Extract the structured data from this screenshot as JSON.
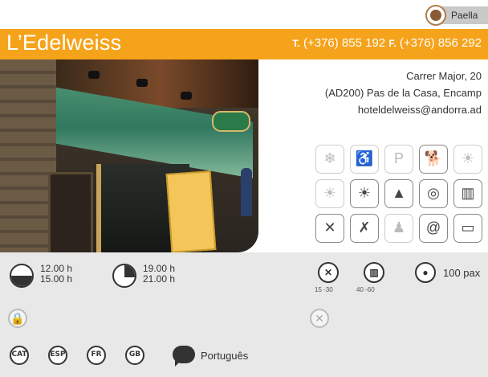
{
  "tag": {
    "label": "Paella",
    "icon": "chef-hat-icon"
  },
  "header": {
    "name": "L’Edelweiss",
    "phone_prefix": "T.",
    "phone": "(+376) 855 192",
    "fax_prefix": "F.",
    "fax": "(+376) 856 292",
    "bar_color": "#f5a31b"
  },
  "photo": {
    "subject": "restaurant-facade"
  },
  "address": {
    "street": "Carrer Major, 20",
    "city": "(AD200) Pas de la Casa, Encamp",
    "email": "hoteldelweiss@andorra.ad"
  },
  "services": [
    {
      "icon": "air-conditioning-icon",
      "glyph": "❄",
      "active": false
    },
    {
      "icon": "wheelchair-icon",
      "glyph": "♿",
      "active": false
    },
    {
      "icon": "parking-icon",
      "glyph": "P",
      "active": false
    },
    {
      "icon": "pets-allowed-icon",
      "glyph": "🐕",
      "active": true
    },
    {
      "icon": "terrace-sun-icon",
      "glyph": "☀",
      "active": false
    },
    {
      "icon": "outdoor-seating-icon",
      "glyph": "☀",
      "active": false
    },
    {
      "icon": "sunset-view-icon",
      "glyph": "☀",
      "active": true
    },
    {
      "icon": "mountain-trees-icon",
      "glyph": "▲",
      "active": true
    },
    {
      "icon": "center-location-icon",
      "glyph": "◎",
      "active": true
    },
    {
      "icon": "menu-book-icon",
      "glyph": "▥",
      "active": true
    },
    {
      "icon": "cutlery-icon",
      "glyph": "✕",
      "active": true
    },
    {
      "icon": "gluten-free-icon",
      "glyph": "✗",
      "active": true
    },
    {
      "icon": "chef-icon",
      "glyph": "♟",
      "active": false
    },
    {
      "icon": "email-at-icon",
      "glyph": "@",
      "active": true
    },
    {
      "icon": "credit-card-icon",
      "glyph": "▭",
      "active": true
    }
  ],
  "hours": {
    "lunch": {
      "open": "12.00 h",
      "close": "15.00 h"
    },
    "dinner": {
      "open": "19.00 h",
      "close": "21.00 h"
    }
  },
  "prices": {
    "menu": {
      "icon": "cutlery-circle-icon",
      "range": "15 -30 "
    },
    "carta": {
      "icon": "menu-circle-icon",
      "range": "40 -60 "
    }
  },
  "capacity": {
    "icon": "people-icon",
    "label": "100 pax"
  },
  "languages": [
    "CAT",
    "ESP",
    "FR",
    "GB"
  ],
  "other_language": "Português"
}
